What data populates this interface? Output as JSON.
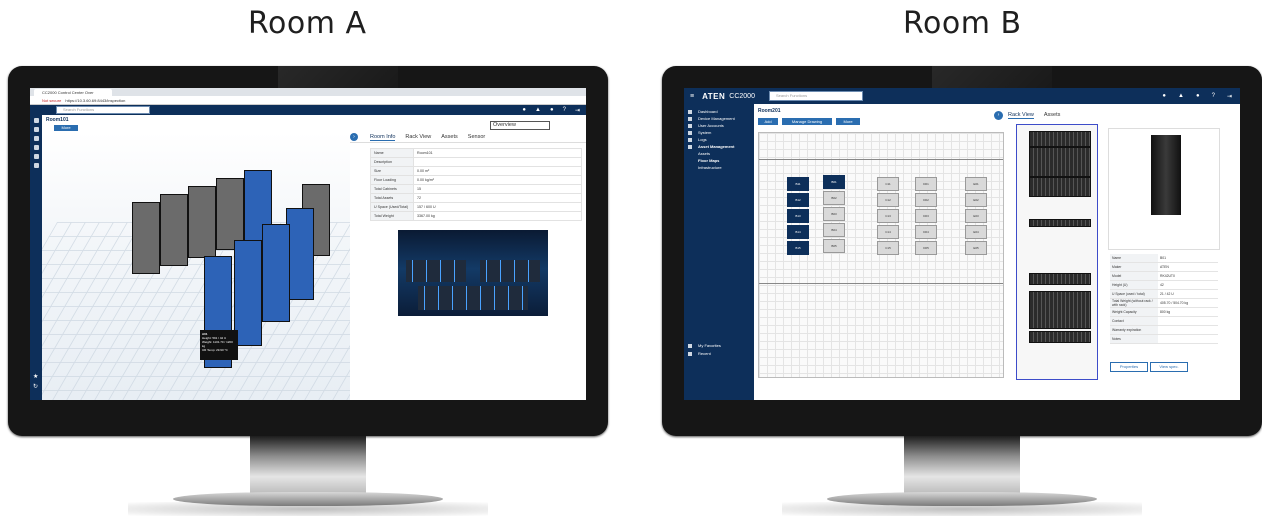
{
  "labels": {
    "room_a": "Room A",
    "room_b": "Room B"
  },
  "room_a": {
    "browser_tab": "CC2000 Control Center Over",
    "address_warning": "Not secure",
    "address": "https://10.3.60.69:8443/inspection",
    "search_placeholder": "Search Functions",
    "breadcrumb": "Room101",
    "more_button": "More",
    "view_select": "Overview",
    "tabs": [
      "Room Info",
      "Rack View",
      "Assets",
      "Sensor"
    ],
    "info": [
      {
        "k": "Name",
        "v": "Room101"
      },
      {
        "k": "Description",
        "v": ""
      },
      {
        "k": "Size",
        "v": "0.00 m²"
      },
      {
        "k": "Floor Loading",
        "v": "0.00 kg/m²"
      },
      {
        "k": "Total Cabinets",
        "v": "15"
      },
      {
        "k": "Total Assets",
        "v": "72"
      },
      {
        "k": "U Space (Used/Total)",
        "v": "157 / 600 U"
      },
      {
        "k": "Total Weight",
        "v": "3367.00 kg"
      }
    ],
    "tooltip": {
      "title": "A01",
      "lines": [
        "Height: 591 / 42 U",
        "Weight: 1101.70 / 1200 kg",
        "UR Temp: 29.90 °C"
      ]
    }
  },
  "room_b": {
    "logo": "ATEN",
    "product": "CC2000",
    "search_placeholder": "Search Functions",
    "breadcrumb": "Room201",
    "sidebar": [
      {
        "label": "Dashboard",
        "caret": "⌄"
      },
      {
        "label": "Device Management",
        "caret": "⌄"
      },
      {
        "label": "User Accounts",
        "caret": "⌄"
      },
      {
        "label": "System",
        "caret": "⌄"
      },
      {
        "label": "Logs",
        "caret": "⌄"
      },
      {
        "label": "Asset Management",
        "caret": "^"
      }
    ],
    "sidebar_sub": [
      "Assets",
      "Floor Maps",
      "Infrastructure"
    ],
    "sidebar_bottom": [
      "My Favorites",
      "Recent"
    ],
    "buttons": [
      "Add",
      "Manage Drawing",
      "More"
    ],
    "tabs": [
      "Rack View",
      "Assets"
    ],
    "rack_side": [
      "Front",
      "Rear"
    ],
    "cabinets_row1": [
      "B01",
      "B02",
      "B03",
      "B04",
      "B05"
    ],
    "cabinets_row2": [
      "B11",
      "B12",
      "B13",
      "B14",
      "B15"
    ],
    "cabinets_row3": [
      "C11",
      "C12",
      "C13",
      "C14",
      "C15"
    ],
    "cabinets_row4": [
      "D01",
      "D02",
      "D03",
      "D04",
      "D05"
    ],
    "cabinets_row5": [
      "E01",
      "E02",
      "E03",
      "E04",
      "E05"
    ],
    "props": [
      {
        "k": "Name",
        "v": "B01"
      },
      {
        "k": "Maker",
        "v": "ATEN"
      },
      {
        "k": "Model",
        "v": "RK42UT0"
      },
      {
        "k": "Height (U)",
        "v": "42"
      },
      {
        "k": "U Space (used / total)",
        "v": "21 / 42 U"
      },
      {
        "k": "Total Weight (without rack / with rack)",
        "v": "405.70 / 504.70 kg"
      },
      {
        "k": "Weight Capacity",
        "v": "800 kg"
      },
      {
        "k": "Contact",
        "v": ""
      },
      {
        "k": "Warranty expiration",
        "v": ""
      },
      {
        "k": "Notes",
        "v": ""
      }
    ],
    "prop_buttons": [
      "Properties",
      "View spec."
    ]
  }
}
